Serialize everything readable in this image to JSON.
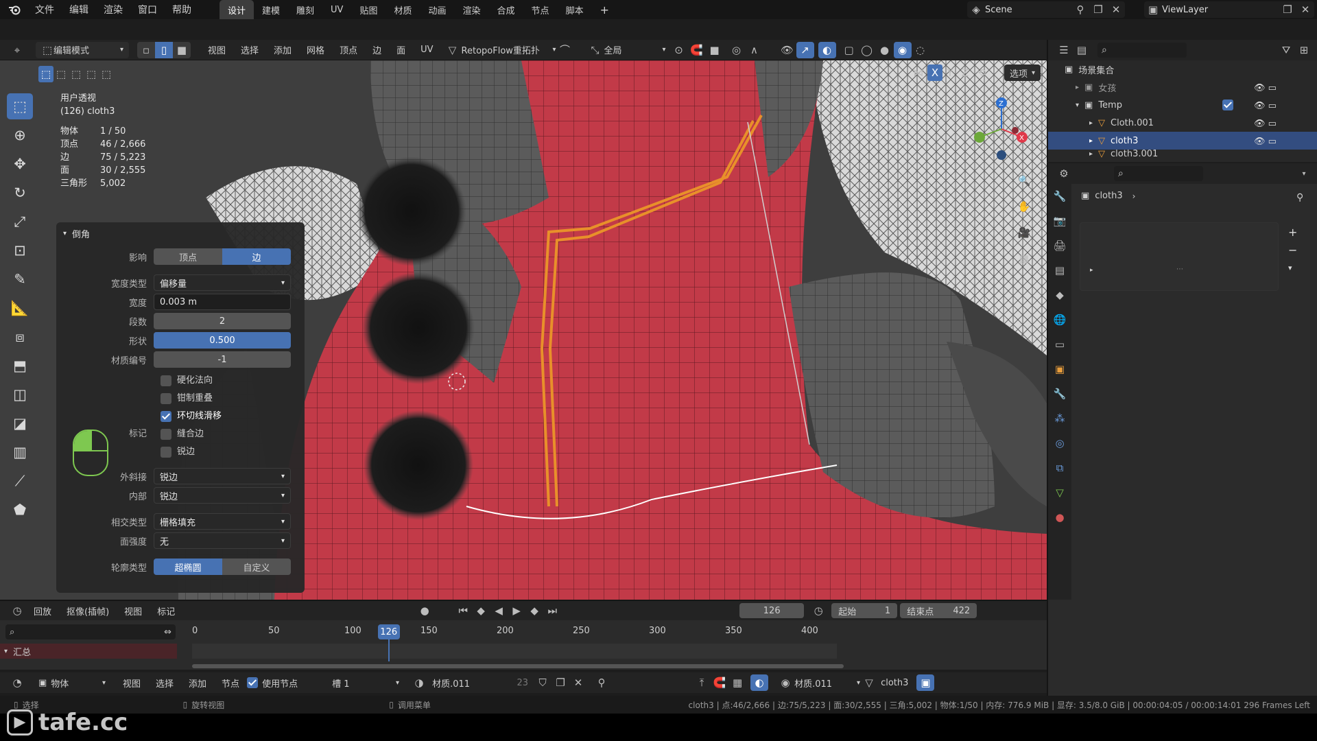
{
  "app": {
    "menus": [
      "文件",
      "编辑",
      "渲染",
      "窗口",
      "帮助"
    ],
    "workspaces": [
      "设计",
      "建模",
      "雕刻",
      "UV",
      "贴图",
      "材质",
      "动画",
      "渲染",
      "合成",
      "节点",
      "脚本"
    ],
    "active_workspace": "设计",
    "scene_label": "Scene",
    "viewlayer_label": "ViewLayer"
  },
  "viewport_header": {
    "mode": "编辑模式",
    "menus": [
      "视图",
      "选择",
      "添加",
      "网格",
      "顶点",
      "边",
      "面",
      "UV"
    ],
    "addon": "RetopoFlow重拓扑",
    "orientation": "全局",
    "options_label": "选项",
    "axes": [
      "X",
      "Y",
      "Z"
    ]
  },
  "overlay_info": {
    "view_name": "用户透视",
    "object_name": "(126) cloth3",
    "stats": [
      {
        "label": "物体",
        "value": "1 / 50"
      },
      {
        "label": "顶点",
        "value": "46 / 2,666"
      },
      {
        "label": "边",
        "value": "75 / 5,223"
      },
      {
        "label": "面",
        "value": "30 / 2,555"
      },
      {
        "label": "三角形",
        "value": "5,002"
      }
    ]
  },
  "bevel_panel": {
    "title": "倒角",
    "affect_label": "影响",
    "affect_options": [
      "顶点",
      "边"
    ],
    "affect_selected": "边",
    "width_type_label": "宽度类型",
    "width_type_value": "偏移量",
    "width_label": "宽度",
    "width_value": "0.003 m",
    "segments_label": "段数",
    "segments_value": "2",
    "shape_label": "形状",
    "shape_value": "0.500",
    "shape_fraction": 0.5,
    "material_label": "材质编号",
    "material_value": "-1",
    "checkboxes": [
      {
        "label": "硬化法向",
        "checked": false
      },
      {
        "label": "钳制重叠",
        "checked": false
      },
      {
        "label": "环切线滑移",
        "checked": true
      }
    ],
    "mark_label": "标记",
    "mark_checkboxes": [
      {
        "label": "缝合边",
        "checked": false
      },
      {
        "label": "锐边",
        "checked": false
      }
    ],
    "outer_miter_label": "外斜接",
    "outer_miter_value": "锐边",
    "inner_miter_label": "内部",
    "inner_miter_value": "锐边",
    "intersection_label": "相交类型",
    "intersection_value": "栅格填充",
    "face_strength_label": "面强度",
    "face_strength_value": "无",
    "profile_label": "轮廓类型",
    "profile_options": [
      "超椭圆",
      "自定义"
    ],
    "profile_selected": "超椭圆"
  },
  "outliner": {
    "title": "场景集合",
    "rows": [
      {
        "name": "女孩",
        "indent": 1
      },
      {
        "name": "Temp",
        "indent": 1
      },
      {
        "name": "Cloth.001",
        "indent": 2
      },
      {
        "name": "cloth3",
        "indent": 2,
        "selected": true
      },
      {
        "name": "cloth3.001",
        "indent": 2
      }
    ]
  },
  "properties": {
    "object_name": "cloth3"
  },
  "timeline": {
    "menus": [
      "回放",
      "抠像(插帧)",
      "视图",
      "标记"
    ],
    "current_frame": "126",
    "start_label": "起始",
    "start_value": "1",
    "end_label": "结束点",
    "end_value": "422",
    "ticks": [
      "0",
      "50",
      "100",
      "150",
      "200",
      "250",
      "300",
      "350",
      "400"
    ],
    "summary_label": "汇总"
  },
  "node_header": {
    "object_mode": "物体",
    "menus": [
      "视图",
      "选择",
      "添加",
      "节点"
    ],
    "use_nodes_label": "使用节点",
    "slot": "槽 1",
    "material": "材质.011",
    "users": "23",
    "material_right": "材质.011",
    "object_right": "cloth3"
  },
  "statusbar": {
    "left": "选择",
    "middle": "旋转视图",
    "right_menu": "调用菜单",
    "info": "cloth3 | 点:46/2,666 | 边:75/5,223 | 面:30/2,555 | 三角:5,002 | 物体:1/50 | 内存: 776.9 MiB | 显存: 3.5/8.0 GiB | 00:00:04:05 / 00:00:14:01 296 Frames Left"
  },
  "watermark": "tafe.cc",
  "colors": {
    "accent": "#4772b3",
    "cloth": "#c23a48",
    "selected_edge": "#e8902a"
  }
}
